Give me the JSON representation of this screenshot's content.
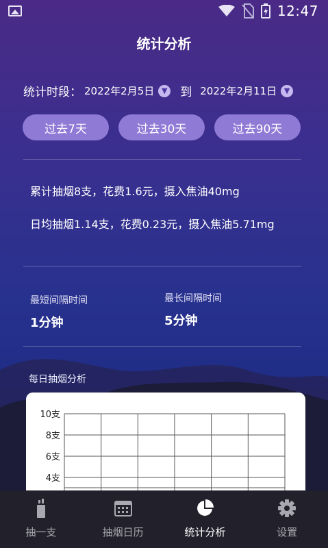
{
  "status": {
    "time": "12:47",
    "icons": [
      "gallery-icon",
      "wifi-icon",
      "no-sim-icon",
      "battery-charging-icon"
    ]
  },
  "header": {
    "title": "统计分析"
  },
  "period": {
    "label": "统计时段：",
    "start": "2022年2月5日",
    "to": "到",
    "end": "2022年2月11日"
  },
  "quick_ranges": [
    "过去7天",
    "过去30天",
    "过去90天"
  ],
  "summary": {
    "total": "累计抽烟8支，花费1.6元，摄入焦油40mg",
    "daily_avg": "日均抽烟1.14支，花费0.23元，摄入焦油5.71mg"
  },
  "intervals": {
    "shortest_label": "最短间隔时间",
    "shortest_value": "1分钟",
    "longest_label": "最长间隔时间",
    "longest_value": "5分钟"
  },
  "daily_chart": {
    "title": "每日抽烟分析"
  },
  "chart_data": {
    "type": "bar",
    "title": "每日抽烟分析",
    "y_tick_labels": [
      "10支",
      "8支",
      "6支",
      "4支"
    ],
    "y_ticks": [
      10,
      8,
      6,
      4
    ],
    "ylim": [
      0,
      10
    ],
    "grid": true,
    "columns": 6
  },
  "tabs": [
    {
      "label": "抽一支",
      "icon": "cigarette-icon",
      "active": false
    },
    {
      "label": "抽烟日历",
      "icon": "calendar-icon",
      "active": false
    },
    {
      "label": "统计分析",
      "icon": "pie-chart-icon",
      "active": true
    },
    {
      "label": "设置",
      "icon": "gear-icon",
      "active": false
    }
  ],
  "colors": {
    "accent": "#8f7ad6",
    "tabbar": "#22212b",
    "active_tab": "#ffffff",
    "inactive_tab": "#a8a8b0"
  }
}
